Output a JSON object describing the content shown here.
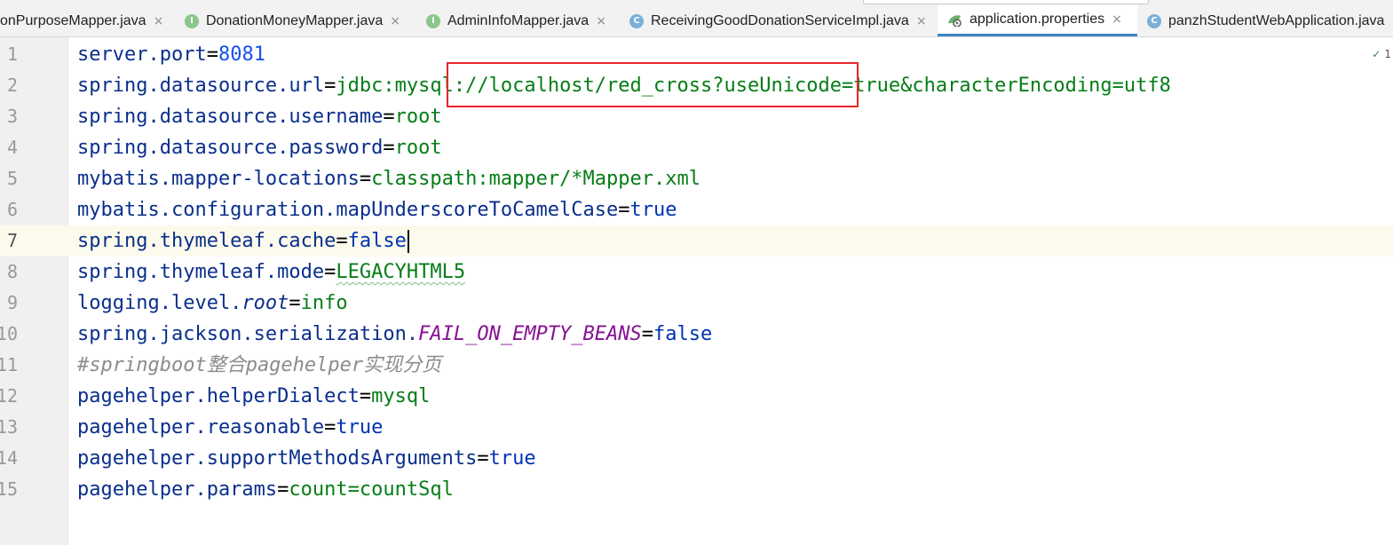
{
  "tabs": [
    {
      "label": "onPurposeMapper.java",
      "icon": "none",
      "active": false
    },
    {
      "label": "DonationMoneyMapper.java",
      "icon": "interface-icon",
      "active": false
    },
    {
      "label": "AdminInfoMapper.java",
      "icon": "interface-icon",
      "active": false
    },
    {
      "label": "ReceivingGoodDonationServiceImpl.java",
      "icon": "class-icon",
      "active": false
    },
    {
      "label": "application.properties",
      "icon": "properties-file-icon",
      "active": true
    },
    {
      "label": "panzhStudentWebApplication.java",
      "icon": "spring-class-icon",
      "active": false
    }
  ],
  "tab_close_glyph": "×",
  "icon_letters": {
    "interface": "I",
    "class": "C"
  },
  "inspection": {
    "check": "✓",
    "count": "1"
  },
  "editor": {
    "current_line": 7,
    "lines": [
      {
        "n": "1",
        "parts": [
          [
            "k",
            "server.port"
          ],
          [
            "eq",
            "="
          ],
          [
            "num",
            "8081"
          ]
        ]
      },
      {
        "n": "2",
        "parts": [
          [
            "k",
            "spring.datasource.url"
          ],
          [
            "eq",
            "="
          ],
          [
            "val",
            "jdbc:mysql://localhost/red_cross?useUnicode=true&characterEncoding=utf8"
          ]
        ]
      },
      {
        "n": "3",
        "parts": [
          [
            "k",
            "spring.datasource.username"
          ],
          [
            "eq",
            "="
          ],
          [
            "val",
            "root"
          ]
        ]
      },
      {
        "n": "4",
        "parts": [
          [
            "k",
            "spring.datasource.password"
          ],
          [
            "eq",
            "="
          ],
          [
            "val",
            "root"
          ]
        ]
      },
      {
        "n": "5",
        "parts": [
          [
            "k",
            "mybatis.mapper-locations"
          ],
          [
            "eq",
            "="
          ],
          [
            "val",
            "classpath:mapper/*Mapper.xml"
          ]
        ]
      },
      {
        "n": "6",
        "parts": [
          [
            "k",
            "mybatis.configuration.mapUnderscoreToCamelCase"
          ],
          [
            "eq",
            "="
          ],
          [
            "kw",
            "true"
          ]
        ]
      },
      {
        "n": "7",
        "parts": [
          [
            "k",
            "spring.thymeleaf.cache"
          ],
          [
            "eq",
            "="
          ],
          [
            "kw",
            "false"
          ]
        ]
      },
      {
        "n": "8",
        "parts": [
          [
            "k",
            "spring.thymeleaf.mode"
          ],
          [
            "eq",
            "="
          ],
          [
            "val squig",
            "LEGACYHTML5"
          ]
        ]
      },
      {
        "n": "9",
        "parts": [
          [
            "k",
            "logging.level."
          ],
          [
            "it",
            "root"
          ],
          [
            "eq",
            "="
          ],
          [
            "val",
            "info"
          ]
        ]
      },
      {
        "n": "10",
        "parts": [
          [
            "k",
            "spring.jackson.serialization."
          ],
          [
            "const",
            "FAIL_ON_EMPTY_BEANS"
          ],
          [
            "eq",
            "="
          ],
          [
            "kw",
            "false"
          ]
        ]
      },
      {
        "n": "11",
        "parts": [
          [
            "cm",
            "#springboot整合pagehelper实现分页"
          ]
        ]
      },
      {
        "n": "12",
        "parts": [
          [
            "k",
            "pagehelper.helperDialect"
          ],
          [
            "eq",
            "="
          ],
          [
            "val",
            "mysql"
          ]
        ]
      },
      {
        "n": "13",
        "parts": [
          [
            "k",
            "pagehelper.reasonable"
          ],
          [
            "eq",
            "="
          ],
          [
            "kw",
            "true"
          ]
        ]
      },
      {
        "n": "14",
        "parts": [
          [
            "k",
            "pagehelper.supportMethodsArguments"
          ],
          [
            "eq",
            "="
          ],
          [
            "kw",
            "true"
          ]
        ]
      },
      {
        "n": "15",
        "parts": [
          [
            "k",
            "pagehelper.params"
          ],
          [
            "eq",
            "="
          ],
          [
            "val",
            "count=countSql"
          ]
        ]
      }
    ]
  },
  "colors": {
    "key": "#0a2f8b",
    "string_value": "#067d17",
    "number": "#1750eb",
    "keyword": "#0033b3",
    "constant": "#871094",
    "comment": "#8c8c8c",
    "highlight_box": "#e8262a",
    "active_tab_underline": "#4083c9"
  }
}
